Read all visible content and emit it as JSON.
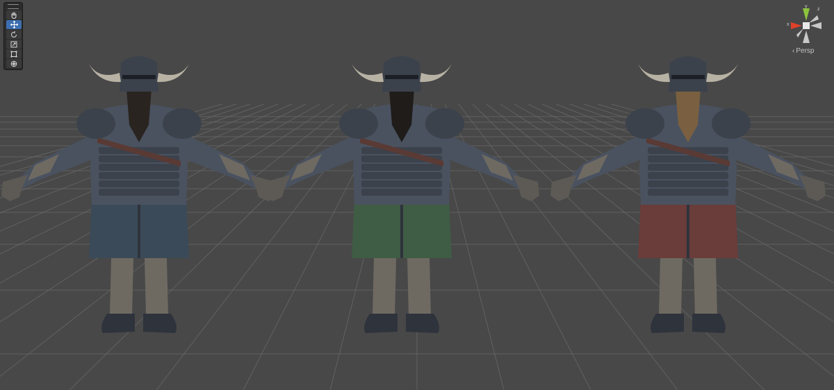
{
  "scene": {
    "background": "#484848",
    "grid_color": "#6a6a6a"
  },
  "toolbar": {
    "tools": [
      {
        "name": "hand-tool",
        "icon": "hand-icon",
        "active": false
      },
      {
        "name": "move-tool",
        "icon": "move-arrows-icon",
        "active": true
      },
      {
        "name": "rotate-tool",
        "icon": "rotate-icon",
        "active": false
      },
      {
        "name": "scale-tool",
        "icon": "scale-icon",
        "active": false
      },
      {
        "name": "rect-tool",
        "icon": "rect-transform-icon",
        "active": false
      },
      {
        "name": "transform-tool",
        "icon": "transform-icon",
        "active": false
      }
    ]
  },
  "gizmo": {
    "x_label": "x",
    "y_label": "y",
    "z_label": "z",
    "x_color": "#e0402a",
    "y_color": "#8cc43c",
    "z_color": "#3a78d8",
    "projection_label": "Persp"
  },
  "characters": [
    {
      "name": "dwarf-blue",
      "tunic_color": "#3a4a58",
      "beard_color": "#2a2420"
    },
    {
      "name": "dwarf-green",
      "tunic_color": "#3f5c44",
      "beard_color": "#1f1c1a"
    },
    {
      "name": "dwarf-red",
      "tunic_color": "#6a3c3a",
      "beard_color": "#7a6040"
    }
  ]
}
